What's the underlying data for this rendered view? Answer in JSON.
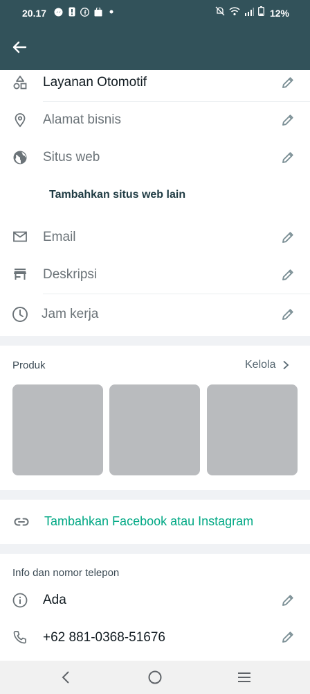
{
  "status_bar": {
    "time": "20.17",
    "battery_percent": "12%"
  },
  "top_bar": {
    "back_icon": "arrow-left-icon"
  },
  "business_info": {
    "rows": [
      {
        "label": "Layanan Otomotif",
        "icon": "category-shapes-icon",
        "filled": true
      },
      {
        "label": "Alamat bisnis",
        "icon": "location-pin-icon",
        "filled": false
      },
      {
        "label": "Situs web",
        "icon": "globe-icon",
        "filled": false
      },
      {
        "label": "Email",
        "icon": "mail-icon",
        "filled": false
      },
      {
        "label": "Deskripsi",
        "icon": "storefront-icon",
        "filled": false
      },
      {
        "label": "Jam kerja",
        "icon": "clock-icon",
        "filled": false
      }
    ],
    "add_website_label": "Tambahkan situs web lain"
  },
  "products": {
    "title": "Produk",
    "manage_label": "Kelola",
    "tile_count": 3
  },
  "social": {
    "link_label": "Tambahkan Facebook atau Instagram"
  },
  "info_phone": {
    "title": "Info dan nomor telepon",
    "about": "Ada",
    "phone": "+62 881-0368-51676"
  },
  "colors": {
    "header": "#32525a",
    "accent": "#00a884",
    "tile": "#b9bbbe"
  }
}
